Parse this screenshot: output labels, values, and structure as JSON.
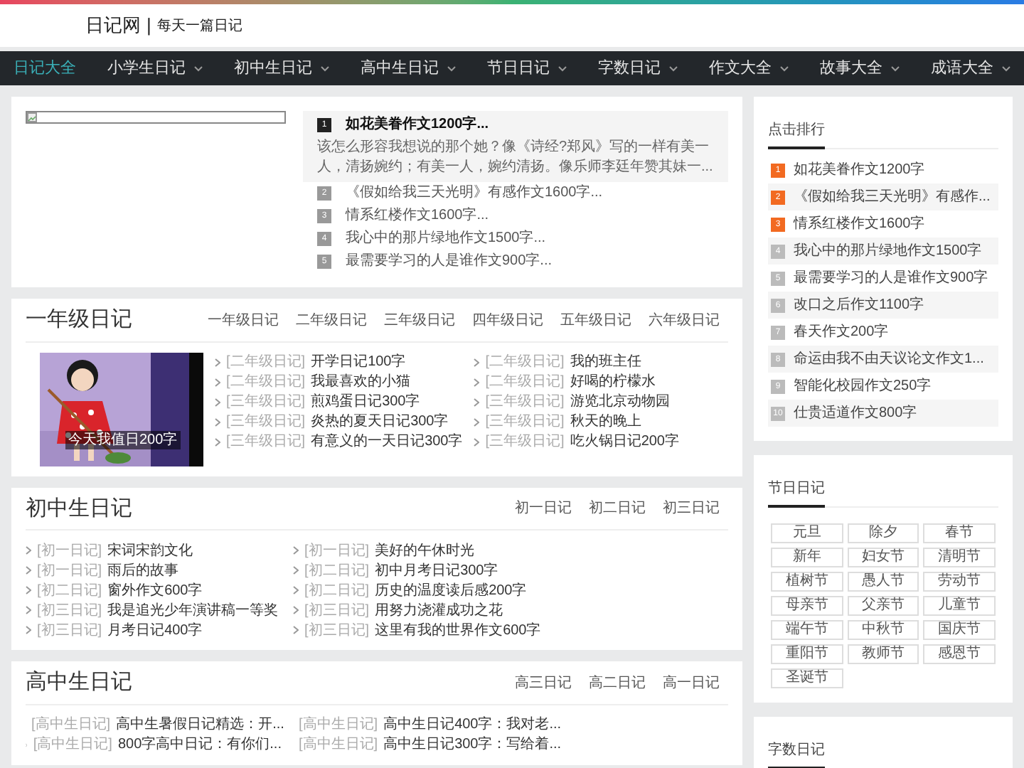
{
  "site": {
    "logo": "日记网",
    "separator": "|",
    "slogan": "每天一篇日记"
  },
  "nav": [
    {
      "label": "日记大全",
      "selected": true,
      "dropdown": false
    },
    {
      "label": "小学生日记",
      "selected": false,
      "dropdown": true
    },
    {
      "label": "初中生日记",
      "selected": false,
      "dropdown": true
    },
    {
      "label": "高中生日记",
      "selected": false,
      "dropdown": true
    },
    {
      "label": "节日日记",
      "selected": false,
      "dropdown": true
    },
    {
      "label": "字数日记",
      "selected": false,
      "dropdown": true
    },
    {
      "label": "作文大全",
      "selected": false,
      "dropdown": true
    },
    {
      "label": "故事大全",
      "selected": false,
      "dropdown": true
    },
    {
      "label": "成语大全",
      "selected": false,
      "dropdown": true
    }
  ],
  "featured": {
    "items": [
      {
        "rank": "1",
        "title": "如花美眷作文1200字...",
        "excerpt": "该怎么形容我想说的那个她？像《诗经?郑风》写的一样有美一人，清扬婉约；有美一人，婉约清扬。像乐师李廷年赞其妹一...",
        "selected": true
      },
      {
        "rank": "2",
        "title": "《假如给我三天光明》有感作文1600字...",
        "selected": false
      },
      {
        "rank": "3",
        "title": "情系红楼作文1600字...",
        "selected": false
      },
      {
        "rank": "4",
        "title": "我心中的那片绿地作文1500字...",
        "selected": false
      },
      {
        "rank": "5",
        "title": "最需要学习的人是谁作文900字...",
        "selected": false
      }
    ]
  },
  "sections": [
    {
      "title": "一年级日记",
      "tabs": [
        "一年级日记",
        "二年级日记",
        "三年级日记",
        "四年级日记",
        "五年级日记",
        "六年级日记"
      ],
      "picture": {
        "caption": "今天我值日200字"
      },
      "columns": [
        [
          {
            "tag": "[二年级日记]",
            "title": "开学日记100字"
          },
          {
            "tag": "[二年级日记]",
            "title": "我最喜欢的小猫"
          },
          {
            "tag": "[三年级日记]",
            "title": "煎鸡蛋日记300字"
          },
          {
            "tag": "[三年级日记]",
            "title": "炎热的夏天日记300字"
          },
          {
            "tag": "[三年级日记]",
            "title": "有意义的一天日记300字"
          }
        ],
        [
          {
            "tag": "[二年级日记]",
            "title": "我的班主任"
          },
          {
            "tag": "[二年级日记]",
            "title": "好喝的柠檬水"
          },
          {
            "tag": "[三年级日记]",
            "title": "游览北京动物园"
          },
          {
            "tag": "[三年级日记]",
            "title": "秋天的晚上"
          },
          {
            "tag": "[三年级日记]",
            "title": "吃火锅日记200字"
          }
        ]
      ]
    },
    {
      "title": "初中生日记",
      "tabs": [
        "初一日记",
        "初二日记",
        "初三日记"
      ],
      "columns": [
        [
          {
            "tag": "[初一日记]",
            "title": "宋词宋韵文化"
          },
          {
            "tag": "[初一日记]",
            "title": "雨后的故事"
          },
          {
            "tag": "[初二日记]",
            "title": "窗外作文600字"
          },
          {
            "tag": "[初三日记]",
            "title": "我是追光少年演讲稿一等奖"
          },
          {
            "tag": "[初三日记]",
            "title": "月考日记400字"
          }
        ],
        [
          {
            "tag": "[初一日记]",
            "title": "美好的午休时光"
          },
          {
            "tag": "[初二日记]",
            "title": "初中月考日记300字"
          },
          {
            "tag": "[初二日记]",
            "title": "历史的温度读后感200字"
          },
          {
            "tag": "[初三日记]",
            "title": "用努力浇灌成功之花"
          },
          {
            "tag": "[初三日记]",
            "title": "这里有我的世界作文600字"
          }
        ]
      ]
    },
    {
      "title": "高中生日记",
      "tabs": [
        "高三日记",
        "高二日记",
        "高一日记"
      ],
      "columns": [
        [
          {
            "tag": "[高中生日记]",
            "title": "高中生暑假日记精选：开..."
          },
          {
            "tag": "[高中生日记]",
            "title": "800字高中日记：有你们..."
          }
        ],
        [
          {
            "tag": "[高中生日记]",
            "title": "高中生日记400字：我对老..."
          },
          {
            "tag": "[高中生日记]",
            "title": "高中生日记300字：写给着..."
          }
        ]
      ]
    }
  ],
  "ranking": {
    "title": "点击排行",
    "items": [
      {
        "rank": "1",
        "title": "如花美眷作文1200字",
        "color": "#f26a21"
      },
      {
        "rank": "2",
        "title": "《假如给我三天光明》有感作...",
        "color": "#f26a21"
      },
      {
        "rank": "3",
        "title": "情系红楼作文1600字",
        "color": "#f26a21"
      },
      {
        "rank": "4",
        "title": "我心中的那片绿地作文1500字",
        "color": "#bbbbbb"
      },
      {
        "rank": "5",
        "title": "最需要学习的人是谁作文900字",
        "color": "#bbbbbb"
      },
      {
        "rank": "6",
        "title": "改口之后作文1100字",
        "color": "#bbbbbb"
      },
      {
        "rank": "7",
        "title": "春天作文200字",
        "color": "#bbbbbb"
      },
      {
        "rank": "8",
        "title": "命运由我不由天议论文作文1...",
        "color": "#bbbbbb"
      },
      {
        "rank": "9",
        "title": "智能化校园作文250字",
        "color": "#bbbbbb"
      },
      {
        "rank": "10",
        "title": "仕贵适道作文800字",
        "color": "#bbbbbb"
      }
    ]
  },
  "festivals": {
    "title": "节日日记",
    "tags": [
      "元旦",
      "除夕",
      "春节",
      "新年",
      "妇女节",
      "清明节",
      "植树节",
      "愚人节",
      "劳动节",
      "母亲节",
      "父亲节",
      "儿童节",
      "端午节",
      "中秋节",
      "国庆节",
      "重阳节",
      "教师节",
      "感恩节",
      "圣诞节"
    ]
  },
  "word_count": {
    "title": "字数日记"
  }
}
